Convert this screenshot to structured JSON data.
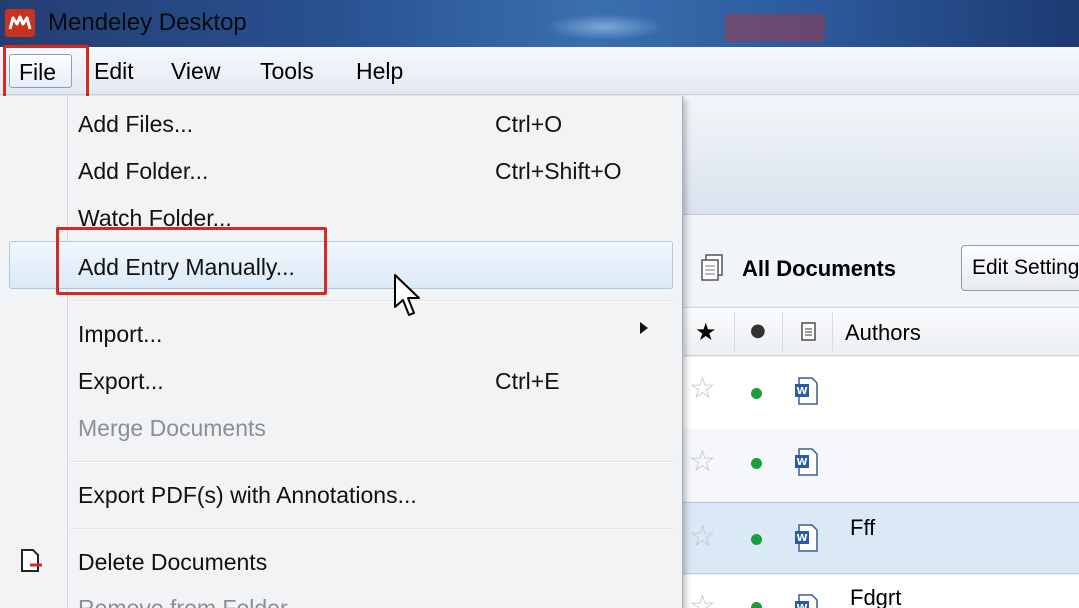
{
  "window": {
    "title": "Mendeley Desktop"
  },
  "menubar": {
    "items": [
      "File",
      "Edit",
      "View",
      "Tools",
      "Help"
    ]
  },
  "file_menu": {
    "add_files": {
      "label": "Add Files...",
      "shortcut": "Ctrl+O"
    },
    "add_folder": {
      "label": "Add Folder...",
      "shortcut": "Ctrl+Shift+O"
    },
    "watch_folder": {
      "label": "Watch Folder..."
    },
    "add_entry_manually": {
      "label": "Add Entry Manually..."
    },
    "import": {
      "label": "Import..."
    },
    "export": {
      "label": "Export...",
      "shortcut": "Ctrl+E"
    },
    "merge_documents": {
      "label": "Merge Documents"
    },
    "export_pdf": {
      "label": "Export PDF(s) with Annotations..."
    },
    "delete_documents": {
      "label": "Delete Documents"
    },
    "remove_from_folder": {
      "label": "Remove from Folder"
    }
  },
  "library": {
    "title": "All Documents",
    "edit_settings": "Edit Settings",
    "columns": {
      "authors": "Authors"
    },
    "rows": [
      {
        "author": ""
      },
      {
        "author": ""
      },
      {
        "author": "Fff"
      },
      {
        "author": "Fdgrt"
      }
    ]
  },
  "colors": {
    "highlight_red": "#d42a20",
    "read_dot_green": "#1c9e3a",
    "logo_red": "#c8321e"
  }
}
